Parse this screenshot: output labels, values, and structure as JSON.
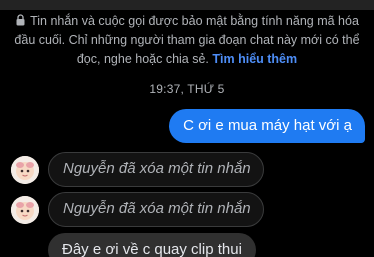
{
  "notice": {
    "text": "Tin nhắn và cuộc gọi được bảo mật bằng tính năng mã hóa đầu cuối. Chỉ những người tham gia đoạn chat này mới có thể đọc, nghe hoặc chia sẻ.",
    "link_label": "Tìm hiểu thêm",
    "icon": "lock-icon"
  },
  "timestamp": "19:37, THỨ 5",
  "messages": [
    {
      "type": "outgoing",
      "text": "C ơi e mua máy hạt với ạ"
    },
    {
      "type": "unsent",
      "text": "Nguyễn đã xóa một tin nhắn"
    },
    {
      "type": "unsent",
      "text": "Nguyễn đã xóa một tin nhắn"
    },
    {
      "type": "incoming",
      "text": "Đây e ơi về c quay clip thui"
    }
  ],
  "colors": {
    "background": "#000000",
    "outgoing_bubble": "#1f7bf2",
    "incoming_bubble": "#303030",
    "link": "#4e8ef7",
    "muted_text": "#b0b3b8"
  }
}
